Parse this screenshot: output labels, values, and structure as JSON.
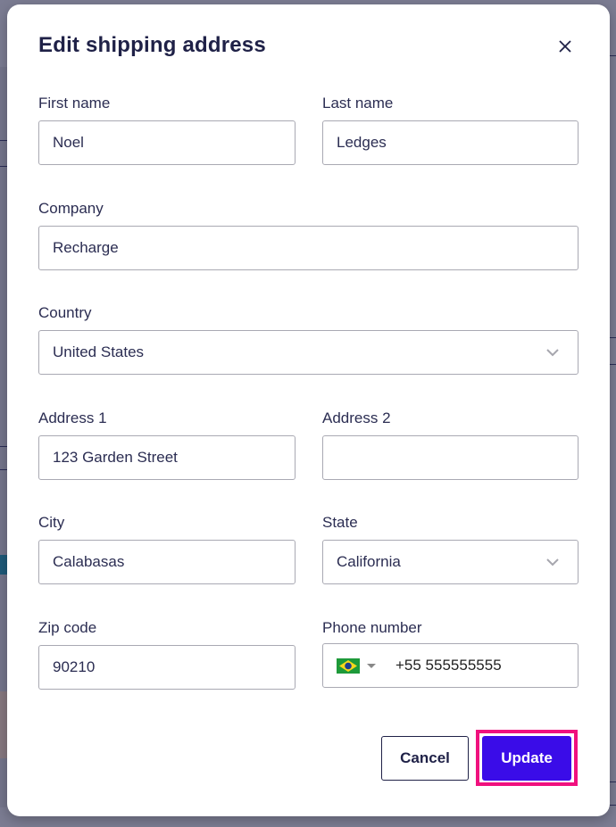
{
  "modal": {
    "title": "Edit shipping address",
    "close_icon": "close-icon"
  },
  "fields": {
    "first_name": {
      "label": "First name",
      "value": "Noel"
    },
    "last_name": {
      "label": "Last name",
      "value": "Ledges"
    },
    "company": {
      "label": "Company",
      "value": "Recharge"
    },
    "country": {
      "label": "Country",
      "value": "United States",
      "icon": "chevron-down-icon"
    },
    "address1": {
      "label": "Address 1",
      "value": "123 Garden Street"
    },
    "address2": {
      "label": "Address 2",
      "value": ""
    },
    "city": {
      "label": "City",
      "value": "Calabasas"
    },
    "state": {
      "label": "State",
      "value": "California",
      "icon": "chevron-down-icon"
    },
    "zip": {
      "label": "Zip code",
      "value": "90210"
    },
    "phone": {
      "label": "Phone number",
      "value": "+55 555555555",
      "country_flag": "brazil-flag-icon"
    }
  },
  "actions": {
    "cancel_label": "Cancel",
    "update_label": "Update"
  },
  "colors": {
    "primary": "#3a0ce8",
    "highlight": "#f0117e",
    "text": "#1f2147",
    "overlay": "#7b7c92"
  }
}
